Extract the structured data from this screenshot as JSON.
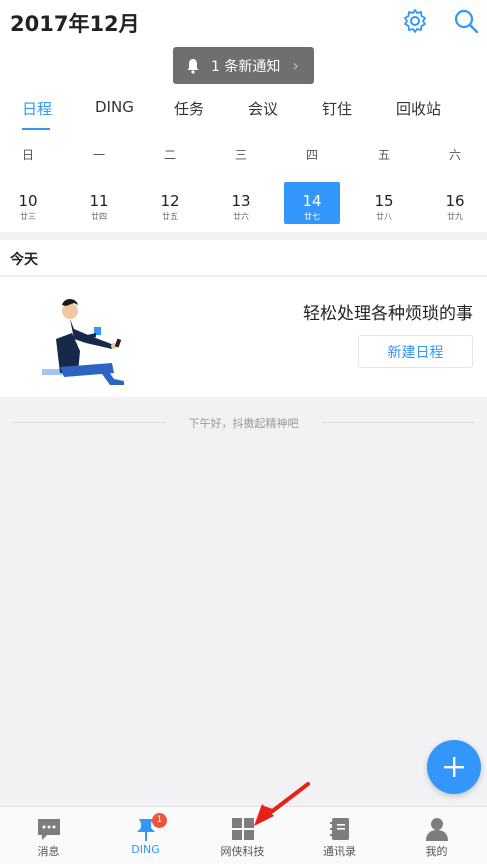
{
  "header": {
    "title": "2017年12月"
  },
  "notice": {
    "text": "1 条新通知"
  },
  "tabs": [
    {
      "label": "日程",
      "active": true
    },
    {
      "label": "DING"
    },
    {
      "label": "任务"
    },
    {
      "label": "会议"
    },
    {
      "label": "钉住"
    },
    {
      "label": "回收站"
    }
  ],
  "calendar": {
    "weekdays": [
      "日",
      "一",
      "二",
      "三",
      "四",
      "五",
      "六"
    ],
    "days": [
      {
        "num": "10",
        "lunar": "廿三"
      },
      {
        "num": "11",
        "lunar": "廿四"
      },
      {
        "num": "12",
        "lunar": "廿五"
      },
      {
        "num": "13",
        "lunar": "廿六"
      },
      {
        "num": "14",
        "lunar": "廿七",
        "selected": true
      },
      {
        "num": "15",
        "lunar": "廿八"
      },
      {
        "num": "16",
        "lunar": "廿九"
      }
    ]
  },
  "today": {
    "heading": "今天",
    "slogan": "轻松处理各种烦琐的事",
    "new_button": "新建日程",
    "greeting": "下午好，抖擞起精神吧"
  },
  "bottom_nav": [
    {
      "label": "消息",
      "icon": "chat-icon"
    },
    {
      "label": "DING",
      "icon": "pin-icon",
      "active": true,
      "badge": "1"
    },
    {
      "label": "网侠科技",
      "icon": "grid-icon"
    },
    {
      "label": "通讯录",
      "icon": "contacts-icon"
    },
    {
      "label": "我的",
      "icon": "person-icon"
    }
  ],
  "colors": {
    "accent": "#3296fa",
    "badge": "#f0533a",
    "arrow": "#e8201a"
  }
}
